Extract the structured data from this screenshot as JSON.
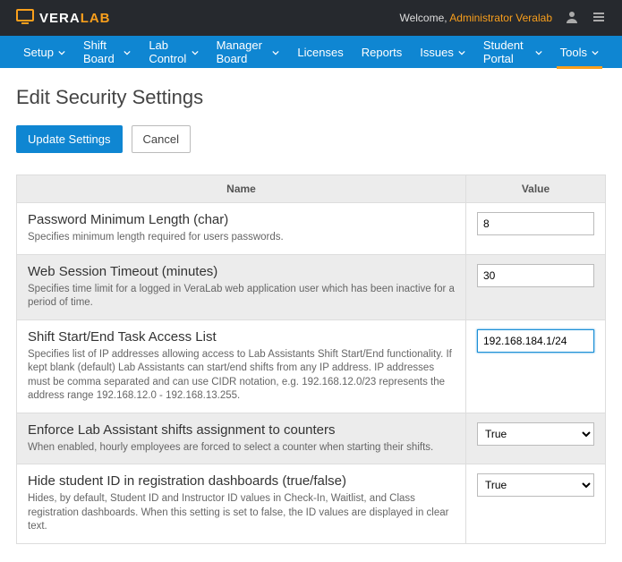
{
  "header": {
    "brand_vera": "VERA",
    "brand_lab": "LAB",
    "welcome": "Welcome,",
    "user": "Administrator Veralab"
  },
  "menu": [
    {
      "label": "Setup",
      "dd": true
    },
    {
      "label": "Shift Board",
      "dd": true
    },
    {
      "label": "Lab Control",
      "dd": true
    },
    {
      "label": "Manager Board",
      "dd": true
    },
    {
      "label": "Licenses",
      "dd": false
    },
    {
      "label": "Reports",
      "dd": false
    },
    {
      "label": "Issues",
      "dd": true
    },
    {
      "label": "Student Portal",
      "dd": true
    },
    {
      "label": "Tools",
      "dd": true,
      "active": true
    }
  ],
  "page": {
    "title": "Edit Security Settings",
    "update_btn": "Update Settings",
    "cancel_btn": "Cancel"
  },
  "table": {
    "col_name": "Name",
    "col_value": "Value"
  },
  "settings": [
    {
      "name": "Password Minimum Length (char)",
      "desc": "Specifies minimum length required for users passwords.",
      "value": "8",
      "control": "text"
    },
    {
      "name": "Web Session Timeout (minutes)",
      "desc": "Specifies time limit for a logged in VeraLab web application user which has been inactive for a period of time.",
      "value": "30",
      "control": "text"
    },
    {
      "name": "Shift Start/End Task Access List",
      "desc": "Specifies list of IP addresses allowing access to Lab Assistants Shift Start/End functionality. If kept blank (default) Lab Assistants can start/end shifts from any IP address. IP addresses must be comma separated and can use CIDR notation, e.g. 192.168.12.0/23 represents the address range 192.168.12.0 - 192.168.13.255.",
      "value": "192.168.184.1/24",
      "control": "text",
      "focused": true
    },
    {
      "name": "Enforce Lab Assistant shifts assignment to counters",
      "desc": "When enabled, hourly employees are forced to select a counter when starting their shifts.",
      "value": "True",
      "control": "select"
    },
    {
      "name": "Hide student ID in registration dashboards (true/false)",
      "desc": "Hides, by default, Student ID and Instructor ID values in Check-In, Waitlist, and Class registration dashboards. When this setting is set to false, the ID values are displayed in clear text.",
      "value": "True",
      "control": "select"
    }
  ]
}
